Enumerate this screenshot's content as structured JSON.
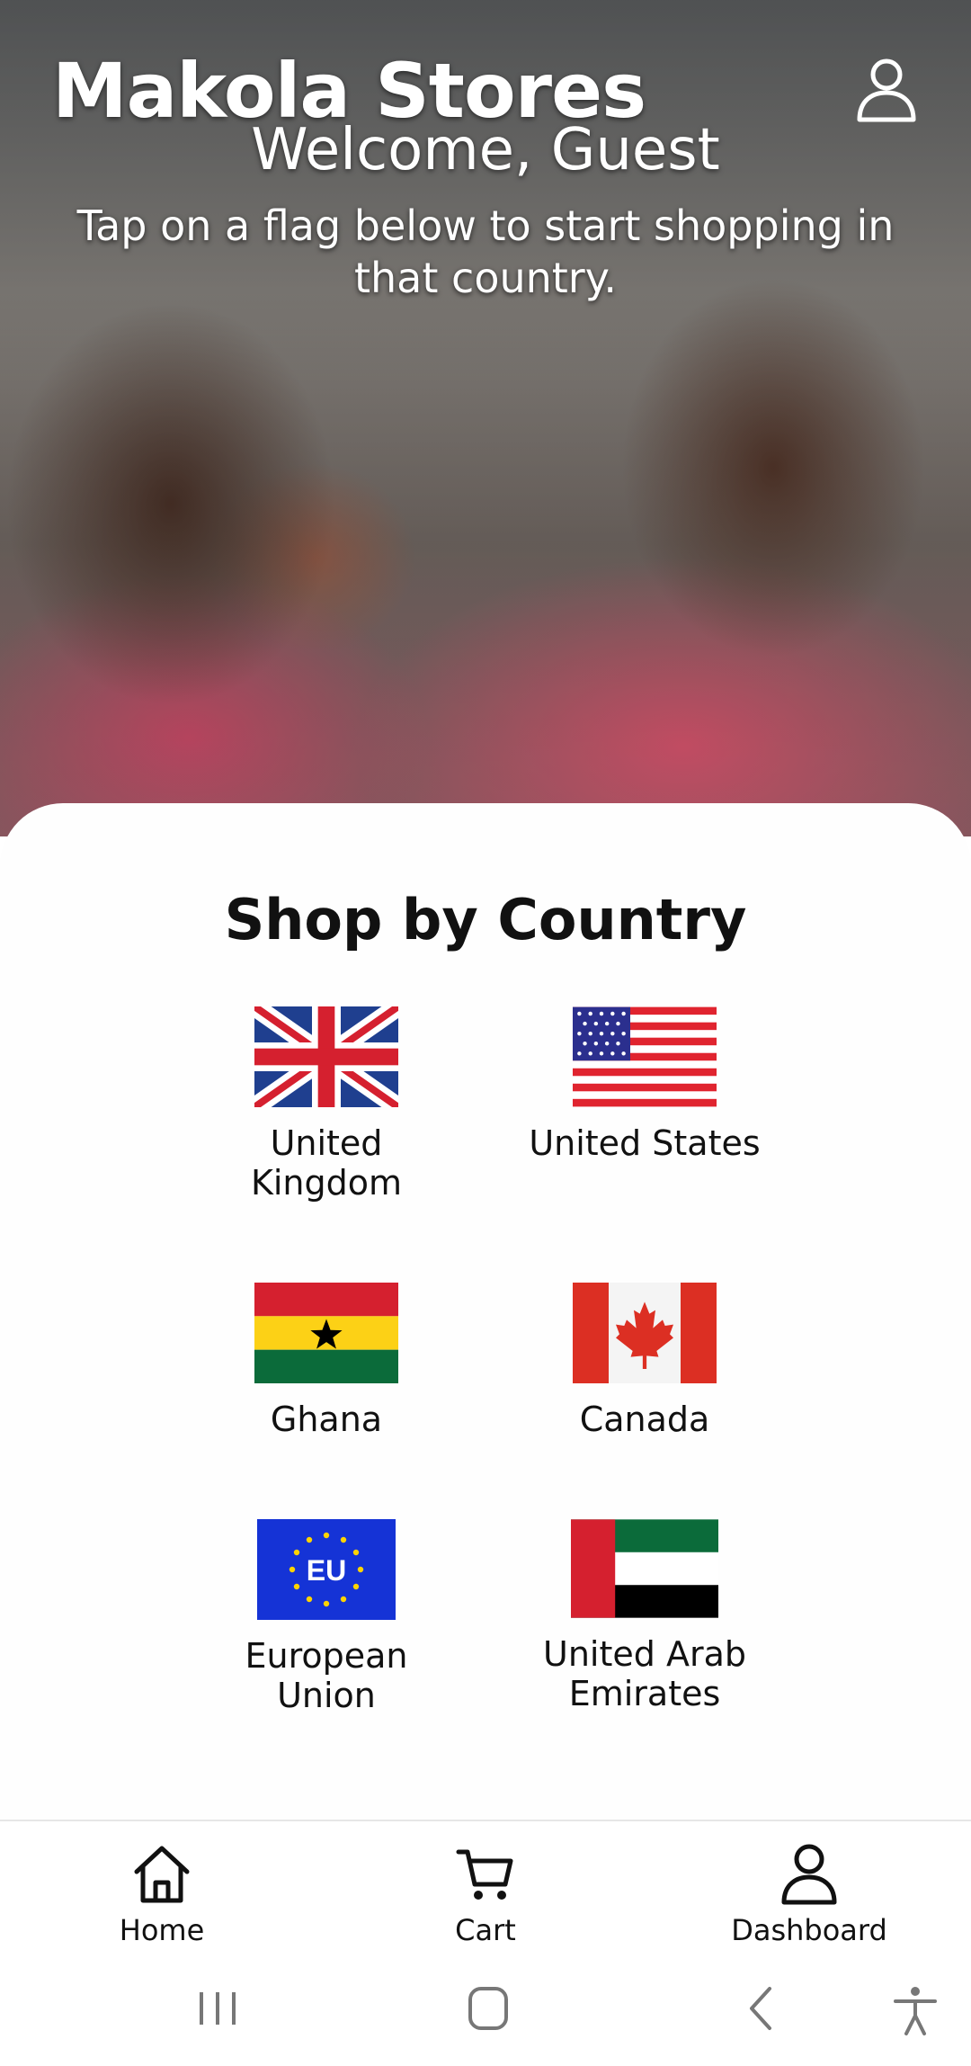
{
  "header": {
    "store_title": "Makola Stores",
    "welcome": "Welcome, Guest",
    "instructions": "Tap on a flag below to start shopping in that country.",
    "account_icon": "user-icon"
  },
  "main": {
    "section_title": "Shop by Country",
    "countries": [
      {
        "label": "United Kingdom",
        "flag": "uk-flag-icon"
      },
      {
        "label": "United States",
        "flag": "us-flag-icon"
      },
      {
        "label": "Ghana",
        "flag": "ghana-flag-icon"
      },
      {
        "label": "Canada",
        "flag": "canada-flag-icon"
      },
      {
        "label": "European Union",
        "flag": "eu-flag-icon"
      },
      {
        "label": "United Arab Emirates",
        "flag": "uae-flag-icon"
      }
    ],
    "eu_flag_text": "EU"
  },
  "bottom_nav": {
    "items": [
      {
        "label": "Home",
        "icon": "home-icon"
      },
      {
        "label": "Cart",
        "icon": "cart-icon"
      },
      {
        "label": "Dashboard",
        "icon": "user-icon"
      }
    ]
  },
  "system_nav": {
    "buttons": [
      "recent-apps-icon",
      "home-button-icon",
      "back-icon",
      "accessibility-icon"
    ]
  }
}
